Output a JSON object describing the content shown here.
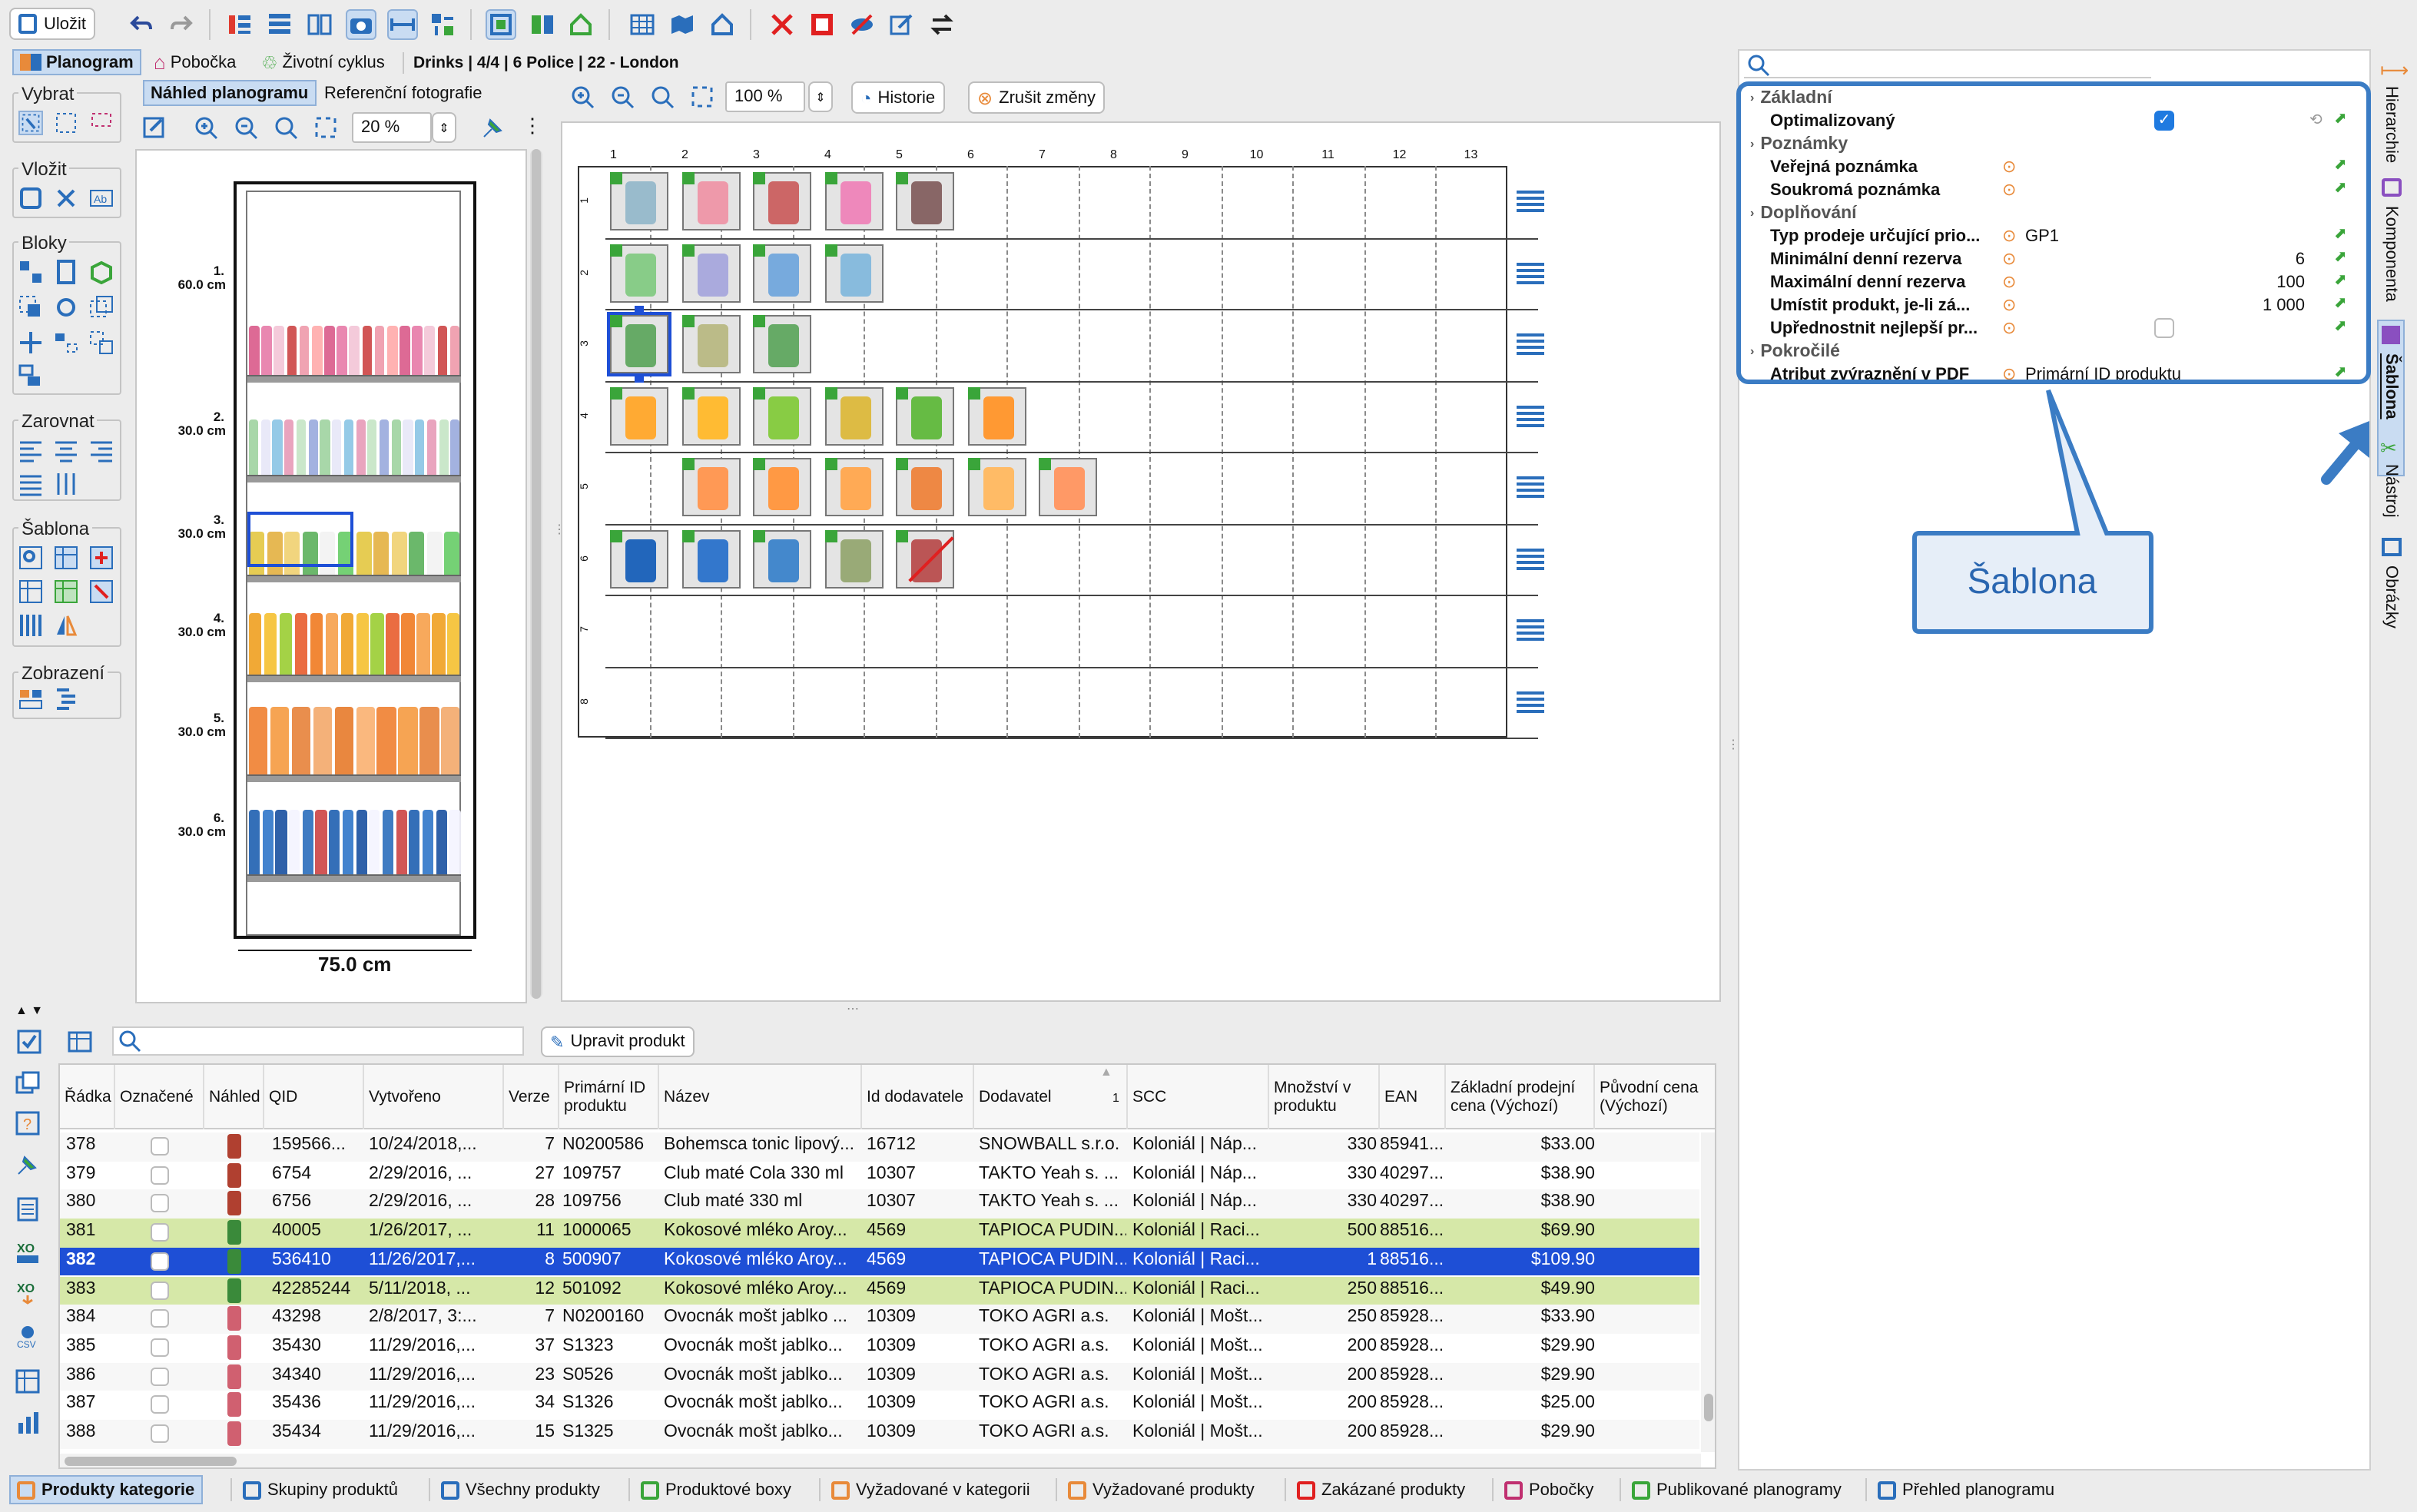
{
  "toolbar": {
    "save_label": "Uložit"
  },
  "tabs": {
    "planogram": "Planogram",
    "store": "Pobočka",
    "lifecycle": "Životní cyklus",
    "breadcrumb": "Drinks | 4/4 | 6 Police | 22 - London"
  },
  "left_panel": {
    "tab_preview": "Náhled planogramu",
    "tab_reference": "Referenční fotografie",
    "zoom": "20 %",
    "groups": [
      "Vybrat",
      "Vložit",
      "Bloky",
      "Zarovnat",
      "Šablona",
      "Zobrazení"
    ]
  },
  "shelf_view": {
    "width_label": "75.0 cm",
    "shelves": [
      {
        "n": "1.",
        "h": "60.0 cm"
      },
      {
        "n": "2.",
        "h": "30.0 cm"
      },
      {
        "n": "3.",
        "h": "30.0 cm"
      },
      {
        "n": "4.",
        "h": "30.0 cm"
      },
      {
        "n": "5.",
        "h": "30.0 cm"
      },
      {
        "n": "6.",
        "h": "30.0 cm"
      }
    ]
  },
  "grid_toolbar": {
    "zoom": "100 %",
    "history": "Historie",
    "cancel": "Zrušit změny"
  },
  "grid": {
    "columns": [
      "1",
      "2",
      "3",
      "4",
      "5",
      "6",
      "7",
      "8",
      "9",
      "10",
      "11",
      "12",
      "13"
    ],
    "rows": [
      "1",
      "2",
      "3",
      "4",
      "5",
      "6",
      "7",
      "8"
    ],
    "row_counts": [
      5,
      4,
      3,
      6,
      6,
      5,
      0,
      0
    ]
  },
  "properties": {
    "sections": {
      "basic": "Základní",
      "notes": "Poznámky",
      "replenishment": "Doplňování",
      "advanced": "Pokročilé"
    },
    "optimized_label": "Optimalizovaný",
    "public_note": "Veřejná poznámka",
    "private_note": "Soukromá poznámka",
    "sales_type_label": "Typ prodeje určující prio...",
    "sales_type_value": "GP1",
    "min_reserve_label": "Minimální denní rezerva",
    "min_reserve_value": "6",
    "max_reserve_label": "Maximální denní rezerva",
    "max_reserve_value": "100",
    "place_label": "Umístit produkt, je-li zá...",
    "place_value": "1 000",
    "prefer_label": "Upřednostnit nejlepší pr...",
    "pdf_label": "Atribut zvýraznění v PDF",
    "pdf_value": "Primární ID produktu"
  },
  "callout": {
    "text": "Šablona"
  },
  "side_tabs": [
    "Hierarchie",
    "Komponenta",
    "Šablona",
    "Nástroj",
    "Obrázky"
  ],
  "products": {
    "edit_button": "Upravit produkt",
    "headers": [
      "Řádka",
      "Označené",
      "Náhled",
      "QID",
      "Vytvořeno",
      "Verze",
      "Primární ID produktu",
      "Název",
      "Id dodavatele",
      "Dodavatel",
      "SCC",
      "Množství v produktu",
      "EAN",
      "Základní prodejní cena (Výchozí)",
      "Původní cena (Výchozí)"
    ],
    "sort_indicator": "1",
    "rows": [
      [
        "378",
        "159566...",
        "10/24/2018,...",
        "7",
        "N0200586",
        "Bohemsca tonic lipový...",
        "16712",
        "SNOWBALL s.r.o.",
        "Koloniál | Náp...",
        "330",
        "85941...",
        "$33.00"
      ],
      [
        "379",
        "6754",
        "2/29/2016, ...",
        "27",
        "109757",
        "Club maté Cola 330 ml",
        "10307",
        "TAKTO Yeah s. ...",
        "Koloniál | Náp...",
        "330",
        "40297...",
        "$38.90"
      ],
      [
        "380",
        "6756",
        "2/29/2016, ...",
        "28",
        "109756",
        "Club maté 330 ml",
        "10307",
        "TAKTO Yeah s. ...",
        "Koloniál | Náp...",
        "330",
        "40297...",
        "$38.90"
      ],
      [
        "381",
        "40005",
        "1/26/2017, ...",
        "11",
        "1000065",
        "Kokosové mléko Aroy...",
        "4569",
        "TAPIOCA PUDIN...",
        "Koloniál | Raci...",
        "500",
        "88516...",
        "$69.90"
      ],
      [
        "382",
        "536410",
        "11/26/2017,...",
        "8",
        "500907",
        "Kokosové mléko Aroy...",
        "4569",
        "TAPIOCA PUDIN...",
        "Koloniál | Raci...",
        "1",
        "88516...",
        "$109.90"
      ],
      [
        "383",
        "42285244",
        "5/11/2018, ...",
        "12",
        "501092",
        "Kokosové mléko Aroy...",
        "4569",
        "TAPIOCA PUDIN...",
        "Koloniál | Raci...",
        "250",
        "88516...",
        "$49.90"
      ],
      [
        "384",
        "43298",
        "2/8/2017, 3:...",
        "7",
        "N0200160",
        "Ovocnák mošt jablko ...",
        "10309",
        "TOKO AGRI a.s.",
        "Koloniál | Mošt...",
        "250",
        "85928...",
        "$33.90"
      ],
      [
        "385",
        "35430",
        "11/29/2016,...",
        "37",
        "S1323",
        "Ovocnák mošt jablko...",
        "10309",
        "TOKO AGRI a.s.",
        "Koloniál | Mošt...",
        "200",
        "85928...",
        "$29.90"
      ],
      [
        "386",
        "34340",
        "11/29/2016,...",
        "23",
        "S0526",
        "Ovocnák mošt jablko...",
        "10309",
        "TOKO AGRI a.s.",
        "Koloniál | Mošt...",
        "200",
        "85928...",
        "$29.90"
      ],
      [
        "387",
        "35436",
        "11/29/2016,...",
        "34",
        "S1326",
        "Ovocnák mošt jablko...",
        "10309",
        "TOKO AGRI a.s.",
        "Koloniál | Mošt...",
        "200",
        "85928...",
        "$25.00"
      ],
      [
        "388",
        "35434",
        "11/29/2016,...",
        "15",
        "S1325",
        "Ovocnák mošt jablko...",
        "10309",
        "TOKO AGRI a.s.",
        "Koloniál | Mošt...",
        "200",
        "85928...",
        "$29.90"
      ]
    ]
  },
  "bottom_tabs": [
    "Produkty kategorie",
    "Skupiny produktů",
    "Všechny produkty",
    "Produktové boxy",
    "Vyžadované v kategorii",
    "Vyžadované produkty",
    "Zakázané produkty",
    "Pobočky",
    "Publikované planogramy",
    "Přehled planogramu"
  ],
  "colors": {
    "accent": "#2a6ebb",
    "selection": "#1e4fd6",
    "highlight": "#d6e8a8",
    "callout_border": "#3b7cc4",
    "callout_bg": "#e6eef8"
  }
}
